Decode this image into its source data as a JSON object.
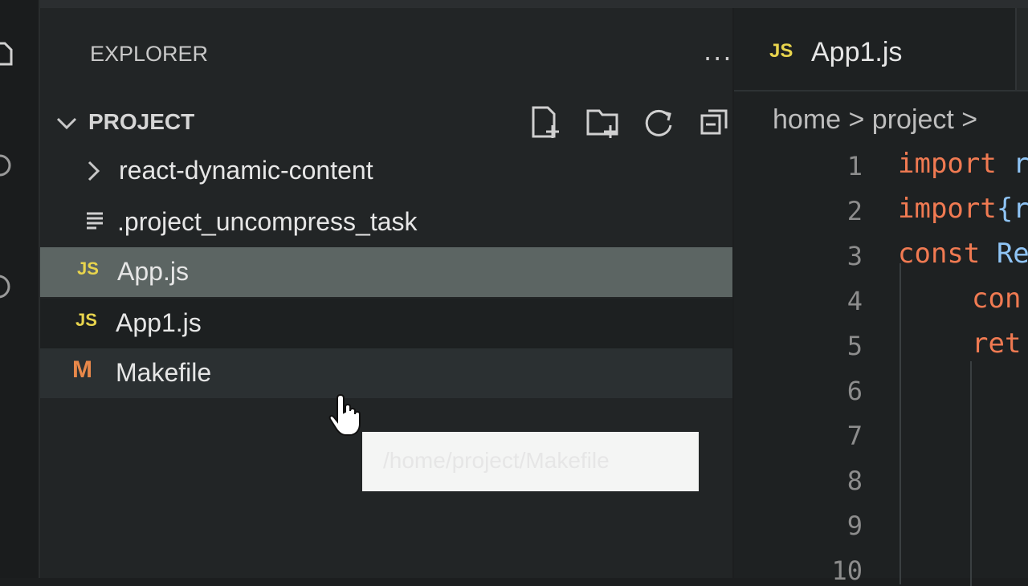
{
  "explorer": {
    "header": "EXPLORER",
    "more": "···",
    "section_title": "PROJECT"
  },
  "tree": [
    {
      "label": "react-dynamic-content",
      "kind": "folder"
    },
    {
      "label": ".project_uncompress_task",
      "kind": "text-file"
    },
    {
      "label": "App.js",
      "kind": "js",
      "badge": "JS"
    },
    {
      "label": "App1.js",
      "kind": "js",
      "badge": "JS"
    },
    {
      "label": "Makefile",
      "kind": "makefile",
      "badge": "M"
    }
  ],
  "tooltip": "/home/project/Makefile",
  "editor": {
    "tab_badge": "JS",
    "tab_label": "App1.js",
    "breadcrumb": "home > project >",
    "line_numbers": [
      "1",
      "2",
      "3",
      "4",
      "5",
      "6",
      "7",
      "8",
      "9",
      "10"
    ],
    "code": [
      {
        "kw": "import",
        "rest": " r"
      },
      {
        "kw": "import",
        "rest": "{r"
      },
      {
        "kw": "const",
        "rest": " Re"
      },
      {
        "kw": "con",
        "rest": ""
      },
      {
        "kw": "ret",
        "rest": ""
      }
    ]
  },
  "colors": {
    "js_badge": "#e8d44d",
    "makefile_badge": "#e8884a",
    "keyword": "#f07a52",
    "selected_row": "#5c6563"
  }
}
